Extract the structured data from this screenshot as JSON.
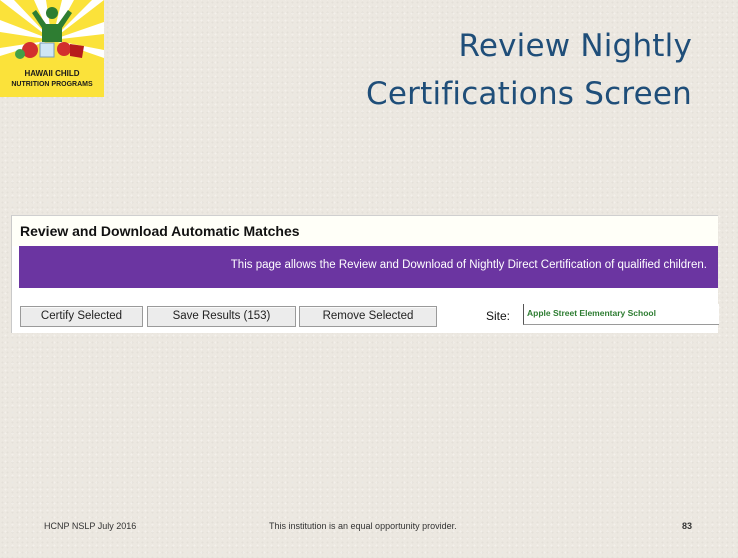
{
  "logo": {
    "line1": "HAWAII CHILD",
    "line2": "NUTRITION PROGRAMS"
  },
  "slide": {
    "title_line1": "Review Nightly",
    "title_line2": "Certifications Screen"
  },
  "panel": {
    "heading": "Review and Download Automatic Matches",
    "banner_text": "This page allows the Review and Download of Nightly Direct Certification of qualified children.",
    "buttons": {
      "certify": "Certify Selected",
      "save": "Save Results (153)",
      "remove": "Remove Selected"
    },
    "site_label": "Site:",
    "site_value": "Apple Street Elementary School"
  },
  "footer": {
    "left": "HCNP NSLP July 2016",
    "center": "This institution is an equal opportunity provider.",
    "page_number": "83"
  },
  "colors": {
    "title": "#1f4e79",
    "banner": "#6b35a1",
    "site_value": "#2e7d32"
  }
}
